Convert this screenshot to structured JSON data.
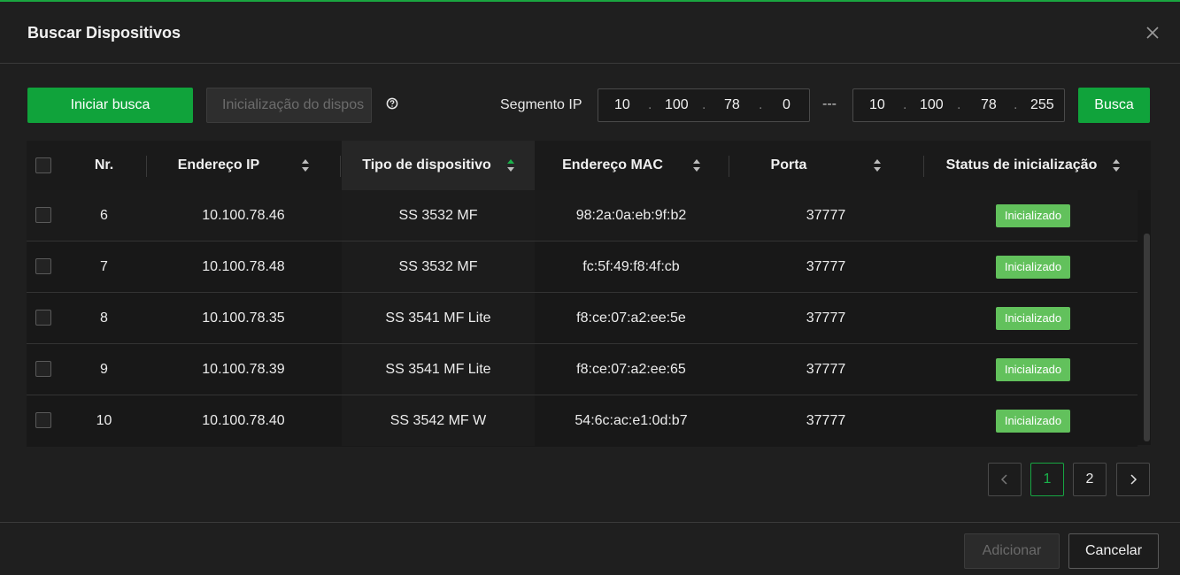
{
  "dialog": {
    "title": "Buscar Dispositivos"
  },
  "toolbar": {
    "start_search_label": "Iniciar busca",
    "init_device_label": "Inicialização do dispos",
    "segment_label": "Segmento IP",
    "ip_start": [
      "10",
      "100",
      "78",
      "0"
    ],
    "ip_end": [
      "10",
      "100",
      "78",
      "255"
    ],
    "range_separator": "---",
    "search_label": "Busca"
  },
  "table": {
    "columns": [
      "Nr.",
      "Endereço IP",
      "Tipo de dispositivo",
      "Endereço MAC",
      "Porta",
      "Status de inicialização"
    ],
    "rows": [
      {
        "nr": "6",
        "ip": "10.100.78.46",
        "tipo": "SS 3532 MF",
        "mac": "98:2a:0a:eb:9f:b2",
        "porta": "37777",
        "status": "Inicializado"
      },
      {
        "nr": "7",
        "ip": "10.100.78.48",
        "tipo": "SS 3532 MF",
        "mac": "fc:5f:49:f8:4f:cb",
        "porta": "37777",
        "status": "Inicializado"
      },
      {
        "nr": "8",
        "ip": "10.100.78.35",
        "tipo": "SS 3541 MF Lite",
        "mac": "f8:ce:07:a2:ee:5e",
        "porta": "37777",
        "status": "Inicializado"
      },
      {
        "nr": "9",
        "ip": "10.100.78.39",
        "tipo": "SS 3541 MF Lite",
        "mac": "f8:ce:07:a2:ee:65",
        "porta": "37777",
        "status": "Inicializado"
      },
      {
        "nr": "10",
        "ip": "10.100.78.40",
        "tipo": "SS 3542 MF W",
        "mac": "54:6c:ac:e1:0d:b7",
        "porta": "37777",
        "status": "Inicializado"
      }
    ]
  },
  "pagination": {
    "pages": [
      "1",
      "2"
    ],
    "current": "1",
    "prev_icon": "chevron-left-icon",
    "next_icon": "chevron-right-icon"
  },
  "footer": {
    "add_label": "Adicionar",
    "cancel_label": "Cancelar"
  },
  "colors": {
    "accent": "#10a33b",
    "badge": "#62c15c",
    "background": "#1f1f1f"
  }
}
